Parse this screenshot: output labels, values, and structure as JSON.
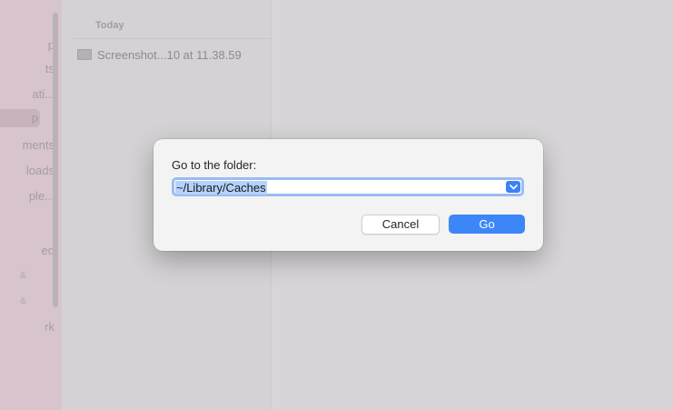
{
  "sidebar": {
    "items": [
      {
        "label": "p"
      },
      {
        "label": "ts"
      },
      {
        "label": "ati..."
      },
      {
        "label": "p"
      },
      {
        "label": "ments"
      },
      {
        "label": "loads"
      },
      {
        "label": "ple..."
      },
      {
        "label": "ed"
      },
      {
        "label": "rk"
      }
    ],
    "badge": "&"
  },
  "file_browser": {
    "section_header": "Today",
    "files": [
      {
        "name": "Screenshot...10 at 11.38.59"
      }
    ]
  },
  "dialog": {
    "title": "Go to the folder:",
    "path_value": "~/Library/Caches",
    "cancel_label": "Cancel",
    "go_label": "Go"
  },
  "colors": {
    "accent": "#3d86f7",
    "field_focus": "#9bbcf2",
    "selection": "#b4d2fb"
  }
}
